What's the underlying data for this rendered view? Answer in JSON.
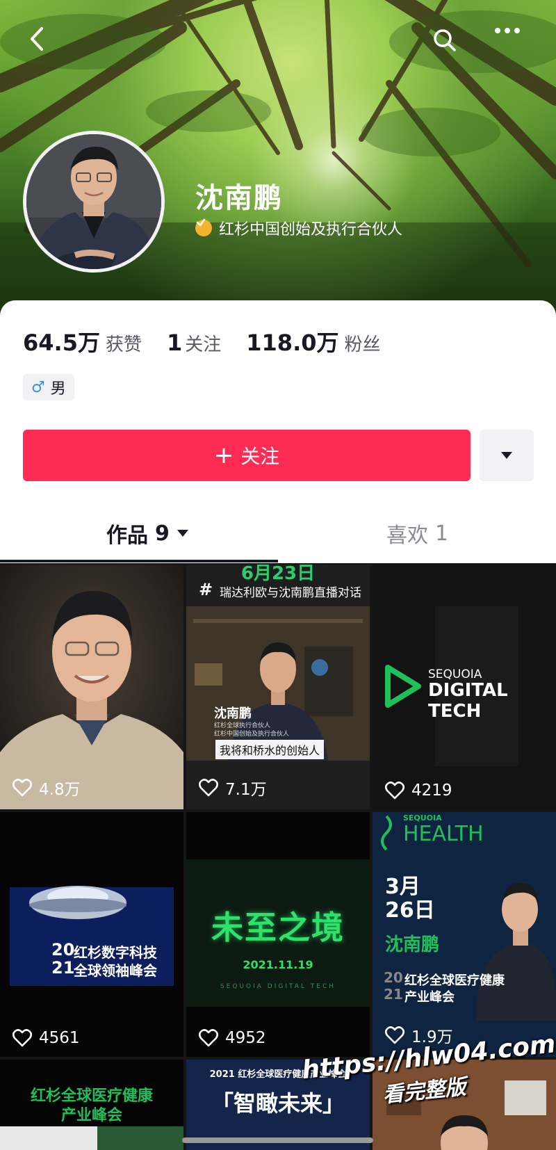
{
  "profile": {
    "name": "沈南鹏",
    "title": "红杉中国创始及执行合伙人",
    "stats": {
      "likes_num": "64.5万",
      "likes_label": "获赞",
      "following_num": "1",
      "following_label": "关注",
      "followers_num": "118.0万",
      "followers_label": "粉丝"
    },
    "gender_symbol": "♂",
    "gender": "男"
  },
  "actions": {
    "follow_plus": "+",
    "follow_label": "关注"
  },
  "tabs": {
    "works_label": "作品",
    "works_count": "9",
    "likes_label": "喜欢",
    "likes_count": "1"
  },
  "videos": [
    {
      "likes": "4.8万",
      "texts": {}
    },
    {
      "likes": "7.1万",
      "texts": {
        "date": "6月23日",
        "hashtag": "#",
        "topic": "瑞达利欧与沈南鹏直播对话",
        "name": "沈南鹏",
        "sub1": "红杉全球执行合伙人",
        "sub2": "红杉中国创始及执行合伙人",
        "caption": "我将和桥水的创始人"
      }
    },
    {
      "likes": "4219",
      "texts": {
        "line1": "SEQUOIA",
        "line2": "DIGITAL TECH"
      }
    },
    {
      "likes": "4561",
      "texts": {
        "y1": "20",
        "y2": "21",
        "t1": "红杉数字科技",
        "t2": "全球领袖峰会"
      }
    },
    {
      "likes": "4952",
      "texts": {
        "title": "未至之境",
        "date": "2021.11.19",
        "brand": "SEQUOIA DIGITAL TECH"
      }
    },
    {
      "likes": "1.9万",
      "texts": {
        "brand_small": "SEQUOIA",
        "brand": "HEALTH",
        "m": "3月",
        "d": "26日",
        "name": "沈南鹏",
        "y1": "20",
        "y2": "21",
        "t1": "红杉全球医疗健康",
        "t2": "产业峰会"
      }
    },
    {
      "likes": "",
      "texts": {
        "t1": "红杉全球医疗健康",
        "t2": "产业峰会"
      }
    },
    {
      "likes": "",
      "texts": {
        "top": "2021 红杉全球医疗健康产业峰会",
        "title": "「智瞰未来」"
      }
    },
    {
      "likes": "",
      "texts": {}
    }
  ],
  "watermark": {
    "line1": "https://hlw04.com",
    "line2": "看完整版"
  },
  "colors": {
    "accent": "#fe2c55",
    "verify": "#f2b52c",
    "gender": "#3d8ee8",
    "seq_green": "#1fbf5a"
  }
}
